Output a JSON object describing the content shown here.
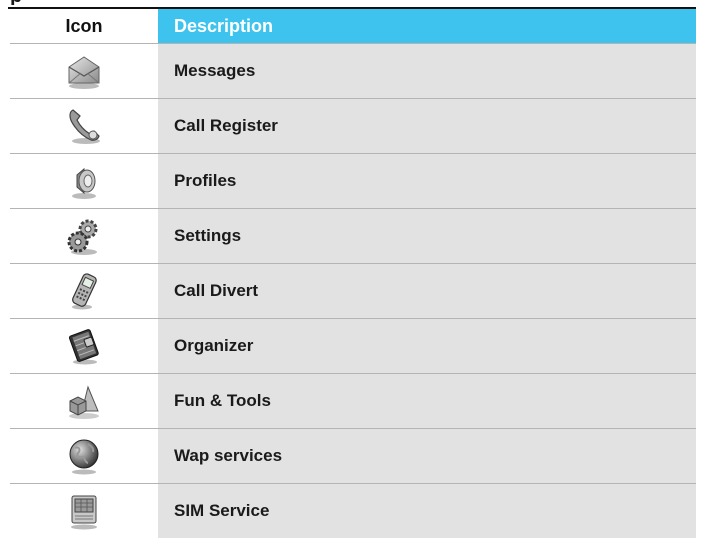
{
  "table": {
    "header": {
      "icon": "Icon",
      "description": "Description"
    },
    "rows": [
      {
        "icon": "envelope-icon",
        "label": "Messages"
      },
      {
        "icon": "phone-handset-icon",
        "label": "Call Register"
      },
      {
        "icon": "speaker-icon",
        "label": "Profiles"
      },
      {
        "icon": "gears-icon",
        "label": "Settings"
      },
      {
        "icon": "mobile-phone-icon",
        "label": "Call Divert"
      },
      {
        "icon": "organizer-book-icon",
        "label": "Organizer"
      },
      {
        "icon": "shapes-icon",
        "label": "Fun & Tools"
      },
      {
        "icon": "globe-icon",
        "label": "Wap services"
      },
      {
        "icon": "sim-card-icon",
        "label": "SIM Service"
      }
    ]
  },
  "colors": {
    "header_accent": "#3ec3ee",
    "row_fill": "#e2e2e2"
  }
}
